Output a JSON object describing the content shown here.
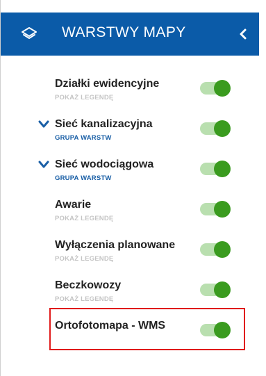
{
  "colors": {
    "header_bg": "#0b5ba8",
    "header_text": "#ffffff",
    "toggle_on_knob": "#3a9b1f",
    "toggle_on_track": "#8bc97a",
    "highlight": "#e01b1b"
  },
  "header": {
    "title": "WARSTWY MAPY",
    "icon": "layers-icon",
    "collapse_icon": "chevron-left-icon"
  },
  "layers": [
    {
      "name": "Działki ewidencyjne",
      "sub": "POKAŻ LEGENDĘ",
      "sub_type": "legend",
      "expandable": false,
      "enabled": true
    },
    {
      "name": "Sieć kanalizacyjna",
      "sub": "GRUPA WARSTW",
      "sub_type": "group",
      "expandable": true,
      "enabled": true
    },
    {
      "name": "Sieć wodociągowa",
      "sub": "GRUPA WARSTW",
      "sub_type": "group",
      "expandable": true,
      "enabled": true
    },
    {
      "name": "Awarie",
      "sub": "POKAŻ LEGENDĘ",
      "sub_type": "legend",
      "expandable": false,
      "enabled": true
    },
    {
      "name": "Wyłączenia planowane",
      "sub": "POKAŻ LEGENDĘ",
      "sub_type": "legend",
      "expandable": false,
      "enabled": true
    },
    {
      "name": "Beczkowozy",
      "sub": "POKAŻ LEGENDĘ",
      "sub_type": "legend",
      "expandable": false,
      "enabled": true
    },
    {
      "name": "Ortofotomapa - WMS",
      "sub": "",
      "sub_type": "none",
      "expandable": false,
      "enabled": true,
      "highlighted": true
    }
  ]
}
